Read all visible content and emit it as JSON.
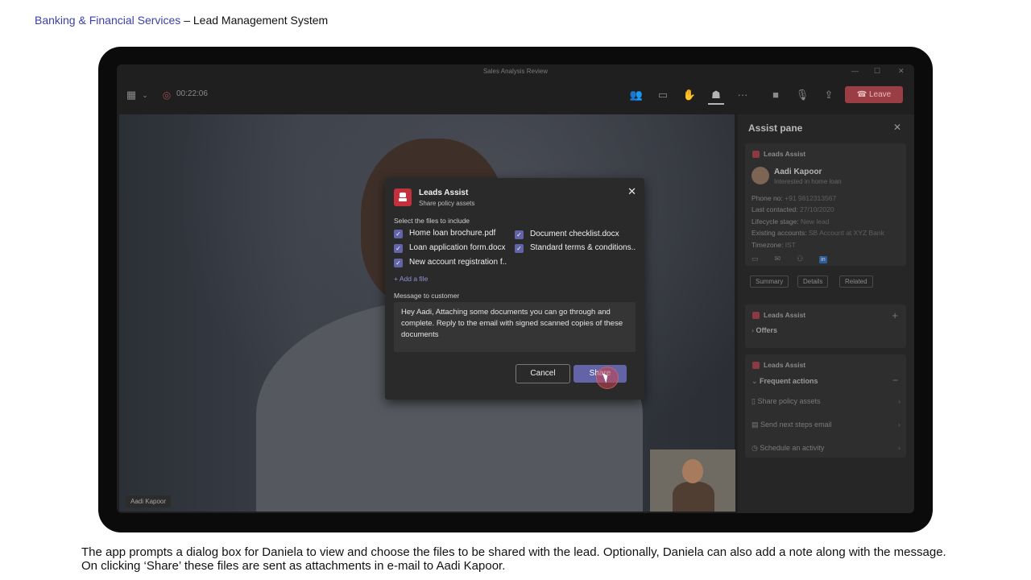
{
  "header": {
    "brand": "Banking & Financial Services",
    "separator": " – ",
    "title": "Lead Management System"
  },
  "window": {
    "title": "Sales Analysis Review"
  },
  "toolbar": {
    "timer": "00:22:06",
    "leave_label": "Leave",
    "icons": [
      "grid-icon",
      "participants-icon",
      "chat-icon",
      "raise-hand-icon",
      "apps-icon",
      "more-icon",
      "camera-icon",
      "mic-icon",
      "share-screen-icon"
    ]
  },
  "video": {
    "participant_name": "Aadi Kapoor"
  },
  "assist_pane": {
    "title": "Assist pane",
    "card1": {
      "app": "Leads Assist",
      "lead_name": "Aadi Kapoor",
      "lead_sub": "Interested in home loan",
      "fields": [
        {
          "label": "Phone no:",
          "value": "+91 9812313567"
        },
        {
          "label": "Last contacted:",
          "value": "27/10/2020"
        },
        {
          "label": "Lifecycle stage:",
          "value": "New lead"
        },
        {
          "label": "Existing accounts:",
          "value": "SB Account at XYZ Bank"
        },
        {
          "label": "Timezone:",
          "value": "IST"
        }
      ],
      "linkedin": "in",
      "pills": [
        "Summary",
        "Details",
        "Related"
      ]
    },
    "card2": {
      "app": "Leads Assist",
      "section": "Offers",
      "add": "+"
    },
    "card3": {
      "app": "Leads Assist",
      "section": "Frequent actions",
      "collapse": "−",
      "actions": [
        "Share policy assets",
        "Send next steps email",
        "Schedule an activity"
      ]
    }
  },
  "dialog": {
    "title": "Leads Assist",
    "subtitle": "Share policy assets",
    "files_label": "Select the files to include",
    "files_left": [
      "Home loan brochure.pdf",
      "Loan application form.docx",
      "New account registration f.."
    ],
    "files_right": [
      "Document checklist.docx",
      "Standard terms & conditions.."
    ],
    "add_file": "+ Add a file",
    "message_label": "Message to customer",
    "message": "Hey Aadi, Attaching some documents you can go through and complete. Reply to the email with signed scanned copies of these documents",
    "cancel_label": "Cancel",
    "share_label": "Share"
  },
  "caption": "The app prompts a dialog box for Daniela to view and choose the files to be shared with the lead. Optionally, Daniela can also add a note along with the message. On clicking ‘Share’ these files are sent as attachments in e-mail to Aadi Kapoor.",
  "colors": {
    "accent": "#6264a7",
    "leave": "#9b3d44",
    "brand_link": "#3b3fa8",
    "app_logo": "#c4313d"
  }
}
